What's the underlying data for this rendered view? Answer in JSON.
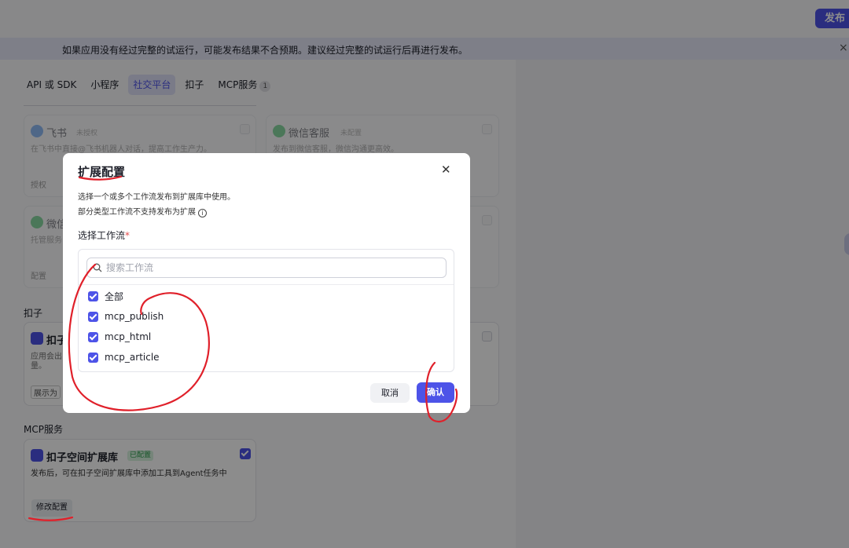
{
  "header": {
    "publish_label": "发布"
  },
  "warning": {
    "text": "如果应用没有经过完整的试运行，可能发布结果不合预期。建议经过完整的试运行后再进行发布。",
    "close_glyph": "×"
  },
  "tabs": [
    {
      "label": "API 或 SDK"
    },
    {
      "label": "小程序"
    },
    {
      "label": "社交平台",
      "active": true
    },
    {
      "label": "扣子"
    },
    {
      "label": "MCP服务",
      "badge": "1"
    }
  ],
  "social": {
    "feishu": {
      "title": "飞书",
      "tag": "未授权",
      "desc": "在飞书中直接@飞书机器人对话，提高工作生产力。",
      "button": "授权"
    },
    "wechat_service": {
      "title": "微信客服",
      "tag": "未配置",
      "desc": "发布到微信客服，微信沟通更高效。"
    },
    "wechat2": {
      "title": "微信",
      "desc": "托管服务",
      "button": "配置"
    }
  },
  "kouzi_section": {
    "label": "扣子",
    "card_title": "扣子",
    "desc_line1": "应用会出",
    "desc_line2": "量。",
    "button": "展示为"
  },
  "mcp_section": {
    "label": "MCP服务",
    "card": {
      "title": "扣子空间扩展库",
      "status_tag": "已配置",
      "desc": "发布后，可在扣子空间扩展库中添加工具到Agent任务中",
      "edit_button": "修改配置",
      "checked": true
    }
  },
  "modal": {
    "title": "扩展配置",
    "close_glyph": "✕",
    "desc1": "选择一个或多个工作流发布到扩展库中使用。",
    "desc2": "部分类型工作流不支持发布为扩展",
    "info_glyph": "i",
    "select_label": "选择工作流",
    "required_mark": "*",
    "search_placeholder": "搜索工作流",
    "items": [
      {
        "label": "全部",
        "checked": true
      },
      {
        "label": "mcp_publish",
        "checked": true
      },
      {
        "label": "mcp_html",
        "checked": true
      },
      {
        "label": "mcp_article",
        "checked": true
      }
    ],
    "cancel_label": "取消",
    "confirm_label": "确认"
  },
  "colors": {
    "accent": "#4d53e8",
    "annotation": "#e0202a",
    "success_bg": "#d8f3df"
  },
  "icons": [
    "search-icon",
    "close-icon",
    "info-icon",
    "checkbox-checked-icon",
    "feishu-icon",
    "wechat-icon",
    "kouzi-icon"
  ]
}
